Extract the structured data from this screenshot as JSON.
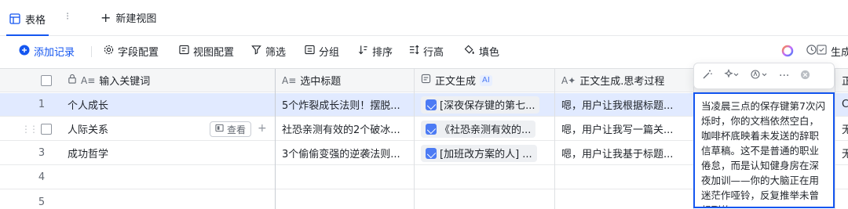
{
  "colors": {
    "accent": "#1456f0",
    "selected_row": "#e1eaff",
    "ai_chip": "#4c7bf4"
  },
  "view_tabs": {
    "active_label": "表格",
    "more": "⁝",
    "new_view_label": "新建视图"
  },
  "toolbar": {
    "add_record": "添加记录",
    "field_config": "字段配置",
    "view_config": "视图配置",
    "filter": "筛选",
    "group": "分组",
    "sort": "排序",
    "row_height": "行高",
    "fill_color": "填色",
    "generate_partial": "生成"
  },
  "columns": [
    {
      "label": "输入关键词",
      "icon": "text-icon"
    },
    {
      "label": "选中标题",
      "icon": "text-icon"
    },
    {
      "label": "正文生成",
      "icon": "doc-icon",
      "badge": "AI"
    },
    {
      "label": "正文生成.思考过程",
      "icon": "ai-text-icon"
    },
    {
      "label": "正",
      "icon": "text-icon"
    }
  ],
  "rows": [
    {
      "num": "1",
      "keyword": "个人成长",
      "title": "5个炸裂成长法则！摆脱...",
      "body": "[深夜保存键的第七...",
      "thinking": "嗯，用户让我根据标题...",
      "extra": "C"
    },
    {
      "num": "",
      "keyword": "人际关系",
      "title": "社恐亲测有效的2个破冰...",
      "body": "《社恐亲测有效的...",
      "thinking": "嗯，用户让我写一篇关...",
      "extra": "无"
    },
    {
      "num": "3",
      "keyword": "成功哲学",
      "title": "3个偷偷变强的逆袭法则...",
      "body": "[加班改方案的人] ...",
      "thinking": "嗯，用户让我基于标题...",
      "extra": "无"
    },
    {
      "num": "4",
      "keyword": "",
      "title": "",
      "body": "",
      "thinking": "",
      "extra": ""
    },
    {
      "num": "5",
      "keyword": "",
      "title": "",
      "body": "",
      "thinking": "",
      "extra": ""
    }
  ],
  "row_actions": {
    "view_label": "查看",
    "add": "+"
  },
  "expanded_cell_text": "当凌晨三点的保存键第7次闪烁时，你的文档依然空白，咖啡杯底映着未发送的辞职信草稿。这不是普通的职业倦怠，而是认知健身房在深夜加训——你的大脑正在用迷茫作哑铃，反复推举未曾想到的"
}
